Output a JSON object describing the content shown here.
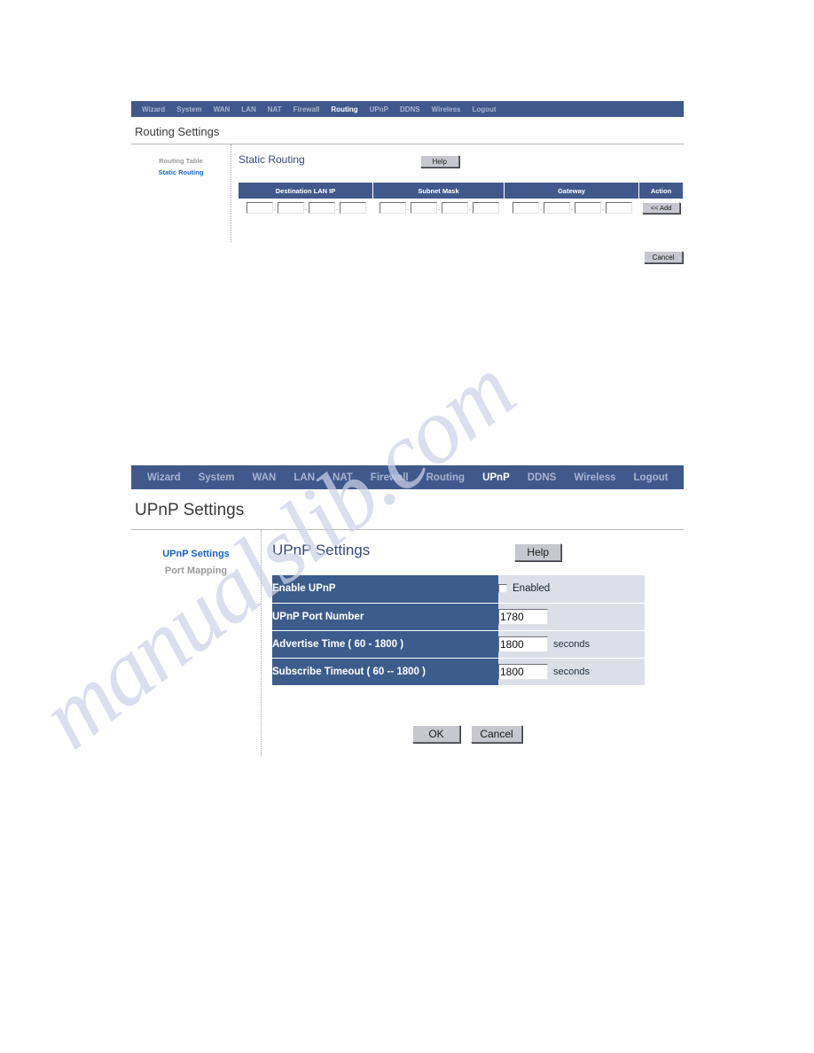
{
  "watermark": {
    "text": "manualslib.com"
  },
  "routing_panel": {
    "nav": {
      "items": [
        {
          "label": "Wizard",
          "active": false
        },
        {
          "label": "System",
          "active": false
        },
        {
          "label": "WAN",
          "active": false
        },
        {
          "label": "LAN",
          "active": false
        },
        {
          "label": "NAT",
          "active": false
        },
        {
          "label": "Firewall",
          "active": false
        },
        {
          "label": "Routing",
          "active": true
        },
        {
          "label": "UPnP",
          "active": false
        },
        {
          "label": "DDNS",
          "active": false
        },
        {
          "label": "Wireless",
          "active": false
        },
        {
          "label": "Logout",
          "active": false
        }
      ]
    },
    "page_title": "Routing Settings",
    "sidebar": {
      "items": [
        {
          "label": "Routing Table",
          "active": false
        },
        {
          "label": "Static Routing",
          "active": true
        }
      ]
    },
    "section_title": "Static Routing",
    "help_label": "Help",
    "table": {
      "headers": [
        "Destination LAN IP",
        "Subnet Mask",
        "Gateway",
        "Action"
      ],
      "row": {
        "destination_lan_ip": [
          "",
          "",
          "",
          ""
        ],
        "subnet_mask": [
          "",
          "",
          "",
          ""
        ],
        "gateway": [
          "",
          "",
          "",
          ""
        ],
        "action_label": "<< Add"
      },
      "dot_separator": "."
    },
    "cancel_label": "Cancel"
  },
  "upnp_panel": {
    "nav": {
      "items": [
        {
          "label": "Wizard",
          "active": false
        },
        {
          "label": "System",
          "active": false
        },
        {
          "label": "WAN",
          "active": false
        },
        {
          "label": "LAN",
          "active": false
        },
        {
          "label": "NAT",
          "active": false
        },
        {
          "label": "Firewall",
          "active": false
        },
        {
          "label": "Routing",
          "active": false
        },
        {
          "label": "UPnP",
          "active": true
        },
        {
          "label": "DDNS",
          "active": false
        },
        {
          "label": "Wireless",
          "active": false
        },
        {
          "label": "Logout",
          "active": false
        }
      ]
    },
    "page_title": "UPnP Settings",
    "sidebar": {
      "items": [
        {
          "label": "UPnP Settings",
          "active": true
        },
        {
          "label": "Port Mapping",
          "active": false
        }
      ]
    },
    "section_title": "UPnP Settings",
    "help_label": "Help",
    "form": {
      "enable_upnp": {
        "label": "Enable UPnP",
        "checkbox_label": "Enabled",
        "checked": false
      },
      "port_number": {
        "label": "UPnP Port Number",
        "value": "1780",
        "unit": ""
      },
      "advertise_time": {
        "label": "Advertise Time ( 60 - 1800 )",
        "value": "1800",
        "unit": "seconds"
      },
      "subscribe_timeout": {
        "label": "Subscribe Timeout ( 60 -- 1800 )",
        "value": "1800",
        "unit": "seconds"
      }
    },
    "ok_label": "OK",
    "cancel_label": "Cancel"
  },
  "colors": {
    "nav_blue": "#41588c",
    "table_header_blue": "#41588c",
    "label_blue": "#3c5c8c",
    "value_lavender": "#dcdfe8",
    "active_link": "#1964c8",
    "inactive_link": "#9a9a9a",
    "section_title": "#34497c"
  }
}
